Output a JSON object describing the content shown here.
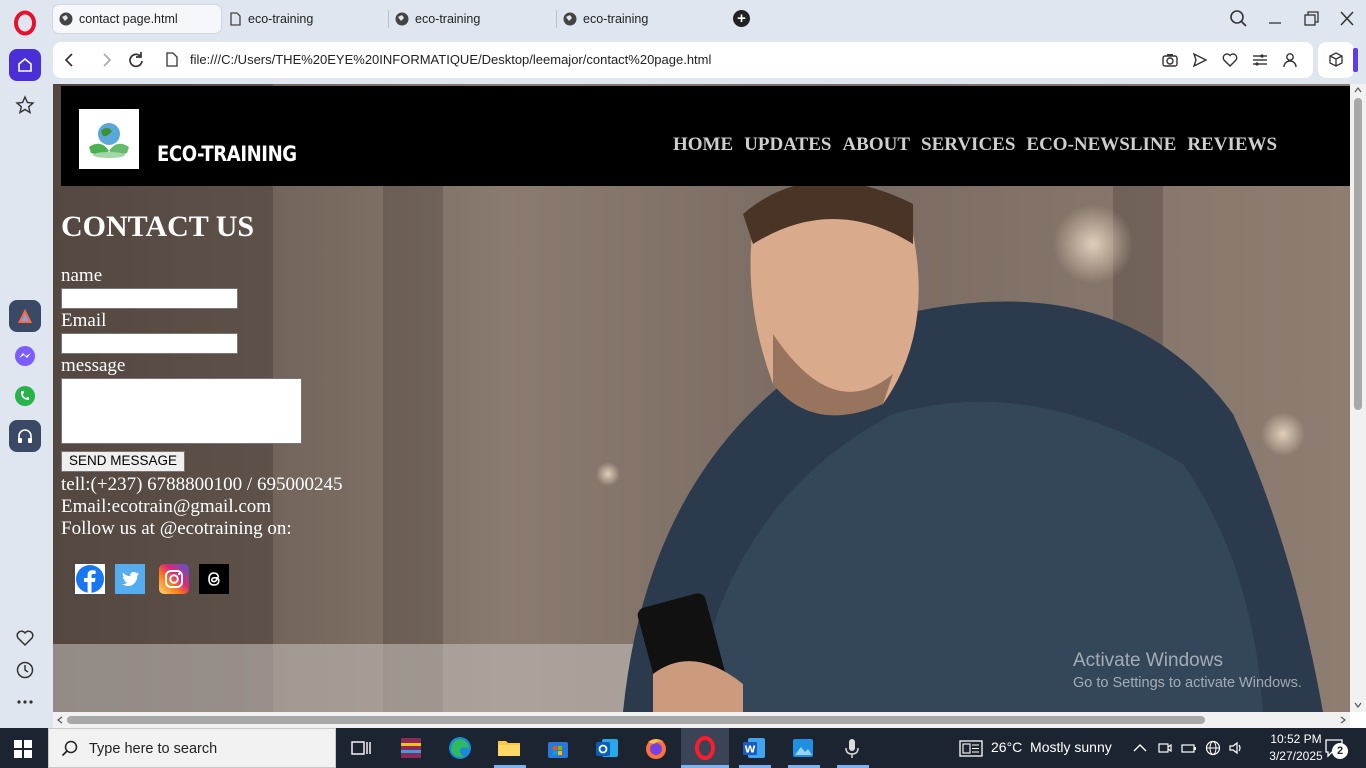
{
  "browser": {
    "tabs": [
      {
        "label": "contact page.html",
        "active": true
      },
      {
        "label": "eco-training",
        "active": false
      },
      {
        "label": "eco-training",
        "active": false
      },
      {
        "label": "eco-training",
        "active": false
      }
    ],
    "url": "file:///C:/Users/THE%20EYE%20INFORMATIQUE/Desktop/leemajor/contact%20page.html",
    "accent_color": "#4b2fd6"
  },
  "site": {
    "title": "ECO-TRAINING",
    "nav": [
      "HOME",
      "UPDATES",
      "ABOUT",
      "SERVICES",
      "ECO-NEWSLINE",
      "REVIEWS"
    ],
    "heading": "CONTACT US",
    "form": {
      "name_label": "name",
      "email_label": "Email",
      "message_label": "message",
      "submit_label": "SEND MESSAGE"
    },
    "contact": {
      "tel": "tell:(+237) 6788800100 / 695000245",
      "email": "Email:ecotrain@gmail.com",
      "follow": "Follow us at @ecotraining on:"
    },
    "socials": [
      "facebook-icon",
      "twitter-icon",
      "instagram-icon",
      "threads-icon"
    ]
  },
  "watermark": {
    "line1": "Activate Windows",
    "line2": "Go to Settings to activate Windows."
  },
  "taskbar": {
    "search_placeholder": "Type here to search",
    "weather": "26°C  Mostly sunny",
    "time": "10:52 PM",
    "date": "3/27/2025",
    "notifications": "2"
  }
}
